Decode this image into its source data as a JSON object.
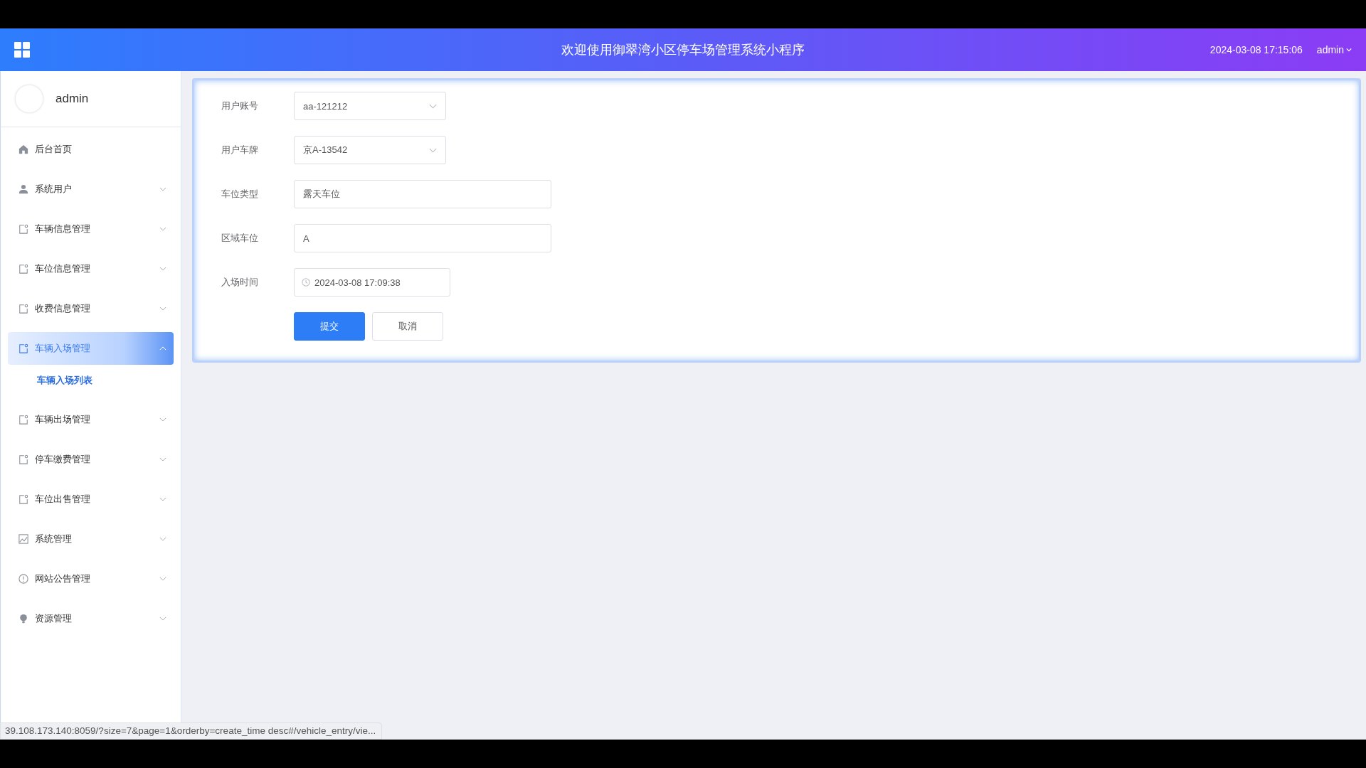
{
  "header": {
    "title": "欢迎使用御翠湾小区停车场管理系统小程序",
    "datetime": "2024-03-08 17:15:06",
    "user": "admin"
  },
  "sidebar": {
    "user": "admin",
    "items": [
      {
        "label": "后台首页",
        "kind": "link",
        "selected": false
      },
      {
        "label": "系统用户",
        "kind": "group",
        "expanded": false,
        "selected": false
      },
      {
        "label": "车辆信息管理",
        "kind": "group",
        "expanded": false,
        "selected": false
      },
      {
        "label": "车位信息管理",
        "kind": "group",
        "expanded": false,
        "selected": false
      },
      {
        "label": "收费信息管理",
        "kind": "group",
        "expanded": false,
        "selected": false
      },
      {
        "label": "车辆入场管理",
        "kind": "group",
        "expanded": true,
        "selected": true,
        "children": [
          {
            "label": "车辆入场列表",
            "selected": true
          }
        ]
      },
      {
        "label": "车辆出场管理",
        "kind": "group",
        "expanded": false,
        "selected": false
      },
      {
        "label": "停车缴费管理",
        "kind": "group",
        "expanded": false,
        "selected": false
      },
      {
        "label": "车位出售管理",
        "kind": "group",
        "expanded": false,
        "selected": false
      },
      {
        "label": "系统管理",
        "kind": "group",
        "expanded": false,
        "selected": false
      },
      {
        "label": "网站公告管理",
        "kind": "group",
        "expanded": false,
        "selected": false
      },
      {
        "label": "资源管理",
        "kind": "group",
        "expanded": false,
        "selected": false
      }
    ]
  },
  "form": {
    "fields": [
      {
        "label": "用户账号",
        "kind": "select",
        "value": "aa-121212"
      },
      {
        "label": "用户车牌",
        "kind": "select",
        "value": "京A-13542"
      },
      {
        "label": "车位类型",
        "kind": "text",
        "value": "露天车位"
      },
      {
        "label": "区域车位",
        "kind": "text",
        "value": "A"
      },
      {
        "label": "入场时间",
        "kind": "datetime",
        "value": "2024-03-08 17:09:38"
      }
    ],
    "buttons": [
      {
        "label": "提交",
        "kind": "primary"
      },
      {
        "label": "取消",
        "kind": "default"
      }
    ]
  },
  "status_url": "39.108.173.140:8059/?size=7&page=1&orderby=create_time desc#/vehicle_entry/vie..."
}
